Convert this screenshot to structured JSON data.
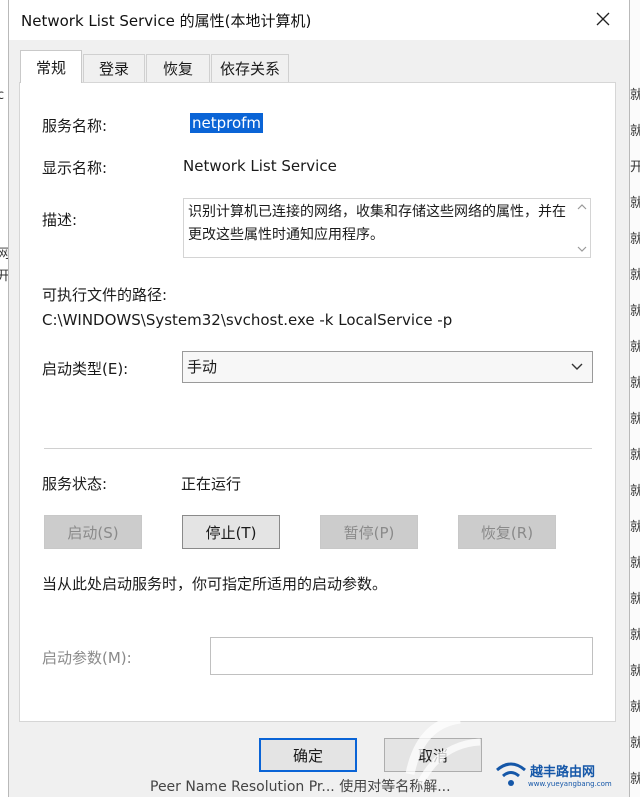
{
  "window": {
    "title": "Network List Service 的属性(本地计算机)"
  },
  "tabs": [
    {
      "label": "常规",
      "active": true
    },
    {
      "label": "登录",
      "active": false
    },
    {
      "label": "恢复",
      "active": false
    },
    {
      "label": "依存关系",
      "active": false
    }
  ],
  "general": {
    "service_name_label": "服务名称:",
    "service_name_value": "netprofm",
    "display_name_label": "显示名称:",
    "display_name_value": "Network List Service",
    "description_label": "描述:",
    "description_value": "识别计算机已连接的网络，收集和存储这些网络的属性，并在更改这些属性时通知应用程序。",
    "exe_path_label": "可执行文件的路径:",
    "exe_path_value": "C:\\WINDOWS\\System32\\svchost.exe -k LocalService -p",
    "startup_type_label": "启动类型(E):",
    "startup_type_value": "手动",
    "status_label": "服务状态:",
    "status_value": "正在运行",
    "control_buttons": {
      "start": "启动(S)",
      "stop": "停止(T)",
      "pause": "暂停(P)",
      "resume": "恢复(R)"
    },
    "hint_text": "当从此处启动服务时，你可指定所适用的启动参数。",
    "start_params_label": "启动参数(M):",
    "start_params_value": ""
  },
  "footer": {
    "ok_label": "确定",
    "cancel_label": "取消"
  },
  "background": {
    "right_glyphs": [
      "就",
      "就",
      "开",
      "就",
      "就",
      "就",
      "就",
      "就",
      "就",
      "就",
      "就",
      "就",
      "就",
      "就",
      "就",
      "就",
      "就",
      "就",
      "就",
      "就"
    ],
    "bottom_text": "Peer Name Resolution Pr... 使用对等名称解..."
  },
  "watermark": {
    "text": "越丰路由网",
    "url": "www.yueyangbang.com"
  },
  "colors": {
    "accent": "#0a64d6",
    "dialog_bg": "#f0f0f0"
  }
}
